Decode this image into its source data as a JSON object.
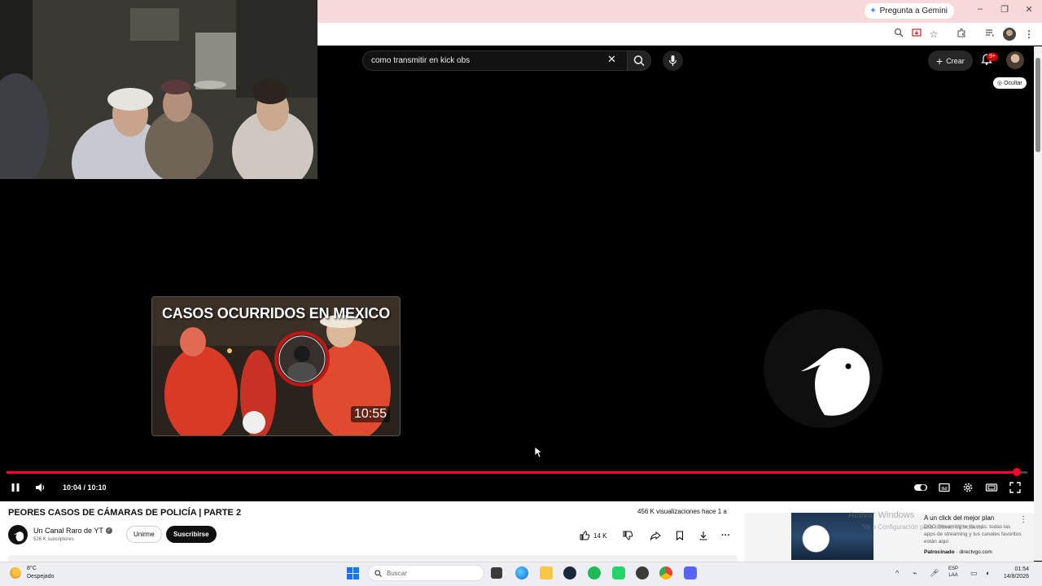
{
  "browser": {
    "gemini_label": "Pregunta a Gemini",
    "window_controls": {
      "minimize": "–",
      "restore": "❐",
      "close": "✕"
    }
  },
  "youtube": {
    "search_query": "como transmitir en kick obs",
    "create_label": "Crear",
    "notification_badge": "9+",
    "hide_label": "Ocultar"
  },
  "player": {
    "end_card": {
      "title": "CASOS OCURRIDOS EN MEXICO",
      "duration": "10:55"
    },
    "time_readout": "10:04 / 10:10",
    "progress_fraction": 0.99,
    "accent_color": "#ff0033"
  },
  "video": {
    "title": "PEORES CASOS DE CÁMARAS DE POLICÍA | PARTE 2",
    "views": "456 K visualizaciones  hace 1 a",
    "channel_name": "Un Canal Raro de YT",
    "subscribers": "526 K suscriptores",
    "join_label": "Unirme",
    "subscribe_label": "Suscribirse",
    "like_count": "14 K"
  },
  "ad": {
    "title": "A un click del mejor plan",
    "description": "DGO Streaming te da más: todas las apps de streaming y tus canales favoritos están aquí",
    "sponsor_label": "Patrocinado",
    "sponsor_domain": "directvgo.com"
  },
  "watermark": {
    "line1": "Activar Windows",
    "line2": "Ve a Configuración para activar Windows."
  },
  "taskbar": {
    "weather_temp": "8°C",
    "weather_desc": "Despejado",
    "search_placeholder": "Buscar",
    "lang_line1": "ESP",
    "lang_line2": "LAA",
    "time": "01:54",
    "date": "14/8/2026"
  }
}
